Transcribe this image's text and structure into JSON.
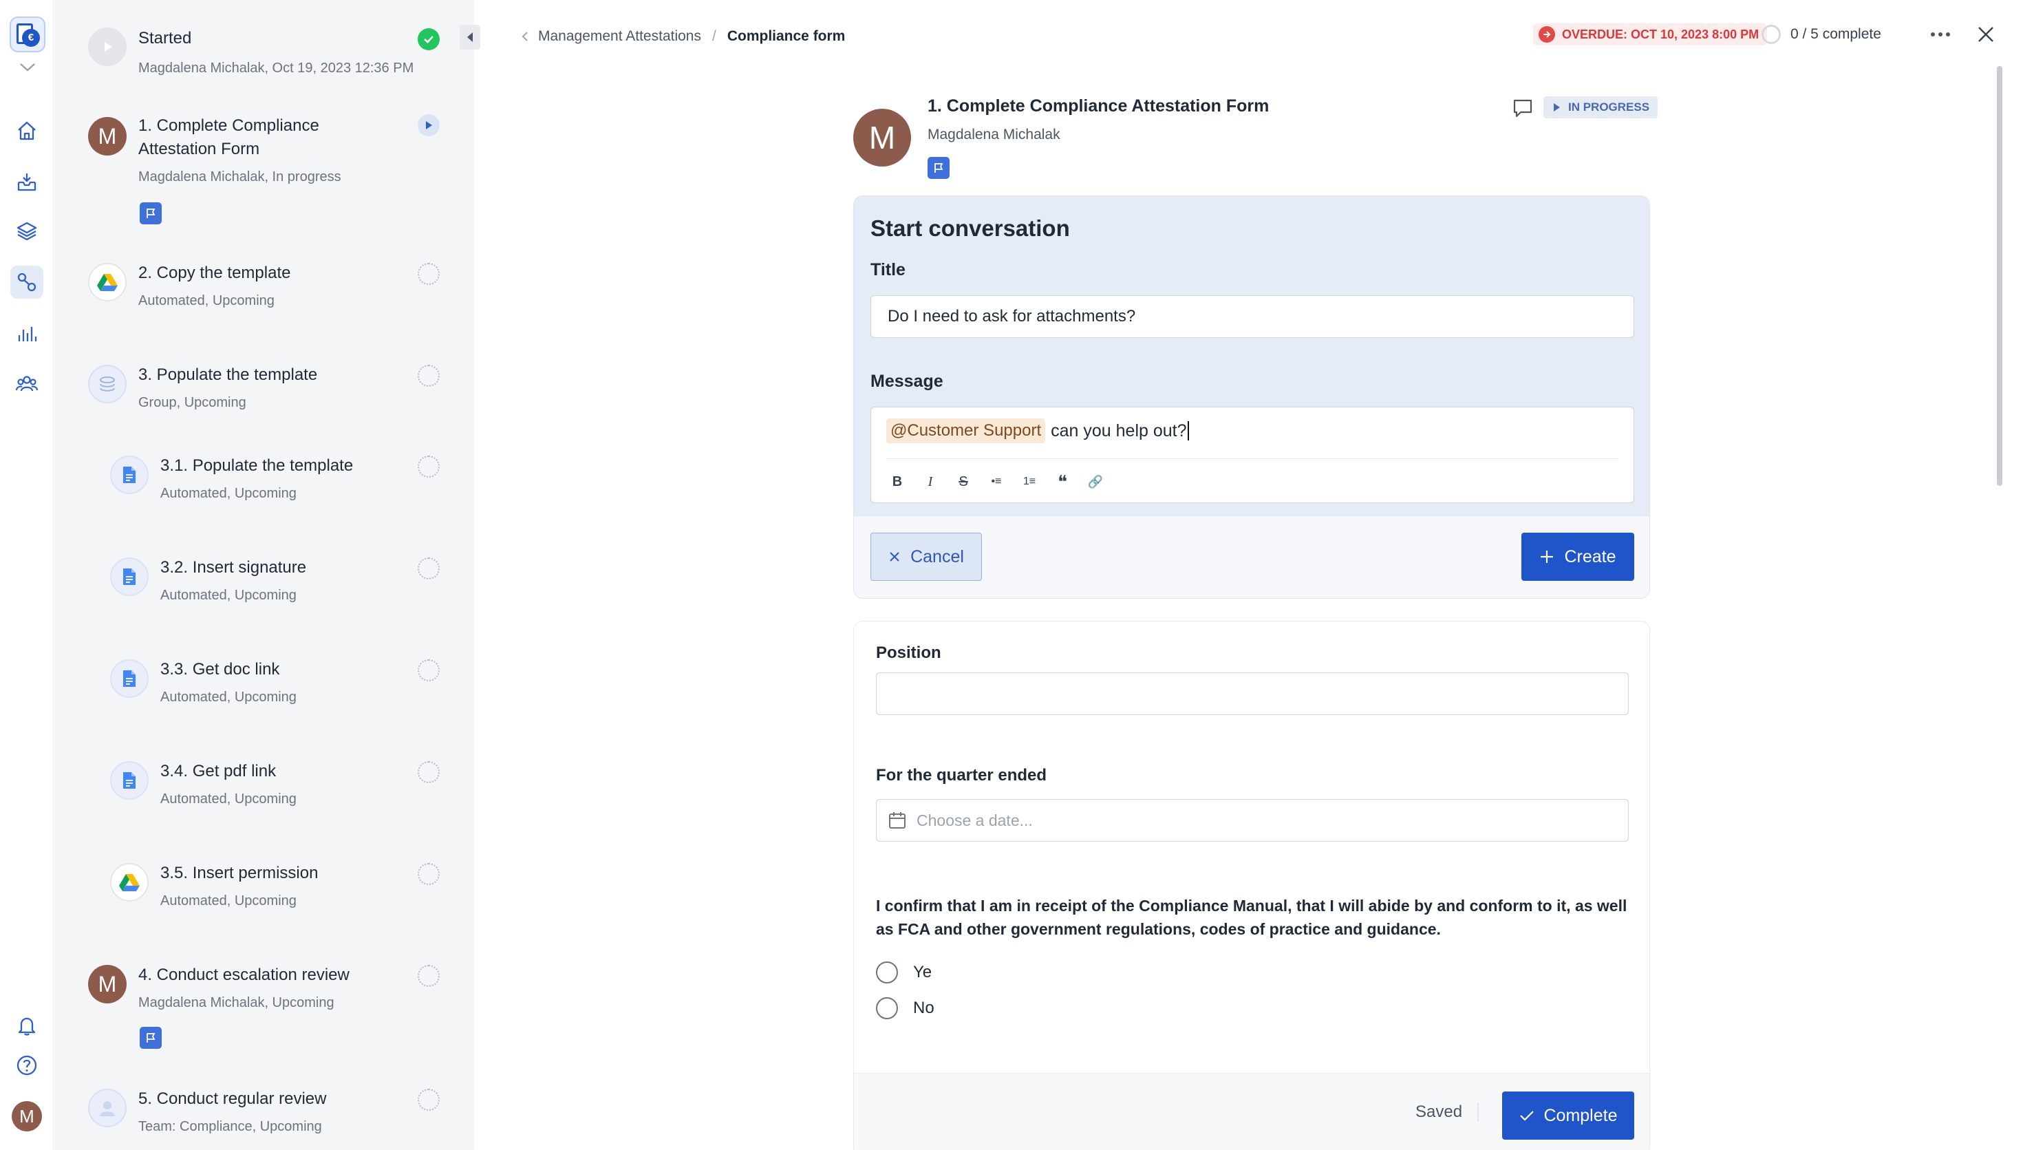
{
  "colors": {
    "accent": "#1f55c9",
    "overdue": "#d83a3a",
    "success": "#22c55e",
    "avatar": "#8d5b4c",
    "panel_bg": "#f4f5f7",
    "convo_bg": "#e6ecf7"
  },
  "rail": {
    "logo_badge": "€",
    "user_initial": "M",
    "items": [
      {
        "name": "home-icon"
      },
      {
        "name": "inbox-icon"
      },
      {
        "name": "layers-icon"
      },
      {
        "name": "workflow-icon",
        "active": true
      },
      {
        "name": "chart-icon"
      },
      {
        "name": "people-icon"
      },
      {
        "name": "bell-icon"
      },
      {
        "name": "help-icon"
      }
    ]
  },
  "steps": [
    {
      "title": "Started",
      "subtitle": "Magdalena Michalak, Oct 19, 2023 12:36 PM",
      "icon": "play-icon",
      "state": "done"
    },
    {
      "title": "1. Complete Compliance Attestation Form",
      "subtitle": "Magdalena Michalak, In progress",
      "icon": "avatar",
      "initial": "M",
      "state": "in-progress",
      "flag": true
    },
    {
      "title": "2. Copy the template",
      "subtitle": "Automated, Upcoming",
      "icon": "google-drive-icon",
      "state": "upcoming"
    },
    {
      "title": "3. Populate the template",
      "subtitle": "Group, Upcoming",
      "icon": "group-stack-icon",
      "state": "upcoming"
    },
    {
      "title": "3.1.  Populate the template",
      "subtitle": "Automated, Upcoming",
      "icon": "google-docs-icon",
      "state": "upcoming"
    },
    {
      "title": "3.2.  Insert signature",
      "subtitle": "Automated, Upcoming",
      "icon": "google-docs-icon",
      "state": "upcoming"
    },
    {
      "title": "3.3.  Get doc link",
      "subtitle": "Automated, Upcoming",
      "icon": "google-docs-icon",
      "state": "upcoming"
    },
    {
      "title": "3.4.  Get pdf link",
      "subtitle": "Automated, Upcoming",
      "icon": "google-docs-icon",
      "state": "upcoming"
    },
    {
      "title": "3.5.  Insert permission",
      "subtitle": "Automated, Upcoming",
      "icon": "google-drive-icon",
      "state": "upcoming"
    },
    {
      "title": "4. Conduct escalation review",
      "subtitle": "Magdalena Michalak, Upcoming",
      "icon": "avatar",
      "initial": "M",
      "state": "upcoming",
      "flag": true
    },
    {
      "title": "5. Conduct regular review",
      "subtitle": "Team: Compliance, Upcoming",
      "icon": "team-icon",
      "state": "upcoming"
    }
  ],
  "header": {
    "breadcrumb_parent": "Management Attestations",
    "breadcrumb_sep": "/",
    "breadcrumb_current": "Compliance form",
    "overdue_label": "OVERDUE: OCT 10, 2023 8:00 PM",
    "progress_label": "0 / 5 complete"
  },
  "task": {
    "initial": "M",
    "title": "1. Complete Compliance Attestation Form",
    "assignee": "Magdalena Michalak",
    "status": "IN PROGRESS"
  },
  "conversation": {
    "heading": "Start conversation",
    "title_label": "Title",
    "title_value": "Do I need to ask for attachments?",
    "message_label": "Message",
    "mention": "@Customer Support",
    "message_text": "can you help out?",
    "toolbar": [
      {
        "name": "bold-button",
        "glyph": "B"
      },
      {
        "name": "italic-button",
        "glyph": "I"
      },
      {
        "name": "strikethrough-button",
        "glyph": "S"
      },
      {
        "name": "bullet-list-button",
        "glyph": "•≡"
      },
      {
        "name": "numbered-list-button",
        "glyph": "1≡"
      },
      {
        "name": "quote-button",
        "glyph": "❝"
      },
      {
        "name": "link-button",
        "glyph": "🔗"
      }
    ],
    "cancel_label": "Cancel",
    "create_label": "Create"
  },
  "form": {
    "position_label": "Position",
    "position_value": "",
    "quarter_label": "For the quarter ended",
    "date_placeholder": "Choose a date...",
    "confirm_text": "I confirm that I am in receipt of the Compliance Manual, that I will abide by and conform to it, as well as FCA and other government regulations, codes of practice and guidance.",
    "options": [
      "Ye",
      "No"
    ],
    "saved_label": "Saved",
    "complete_label": "Complete"
  }
}
